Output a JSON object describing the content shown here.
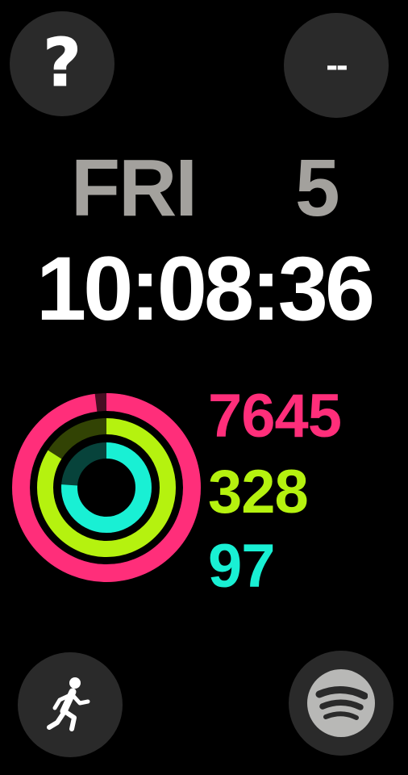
{
  "complications": {
    "top_left": {
      "text": "?",
      "icon": "question-mark-icon"
    },
    "top_right": {
      "text": "--",
      "icon": "empty-complication"
    },
    "bottom_left": {
      "icon": "running-figure-icon"
    },
    "bottom_right": {
      "icon": "spotify-icon"
    }
  },
  "clock": {
    "day": "FRI",
    "date": "5",
    "time": "10:08:36"
  },
  "activity": {
    "move": {
      "value": "7645",
      "color": "#ff2e7a",
      "progress": 0.98
    },
    "exercise": {
      "value": "328",
      "color": "#b5f20f",
      "progress": 0.84
    },
    "stand": {
      "value": "97",
      "color": "#19f0d4",
      "progress": 0.76
    }
  }
}
